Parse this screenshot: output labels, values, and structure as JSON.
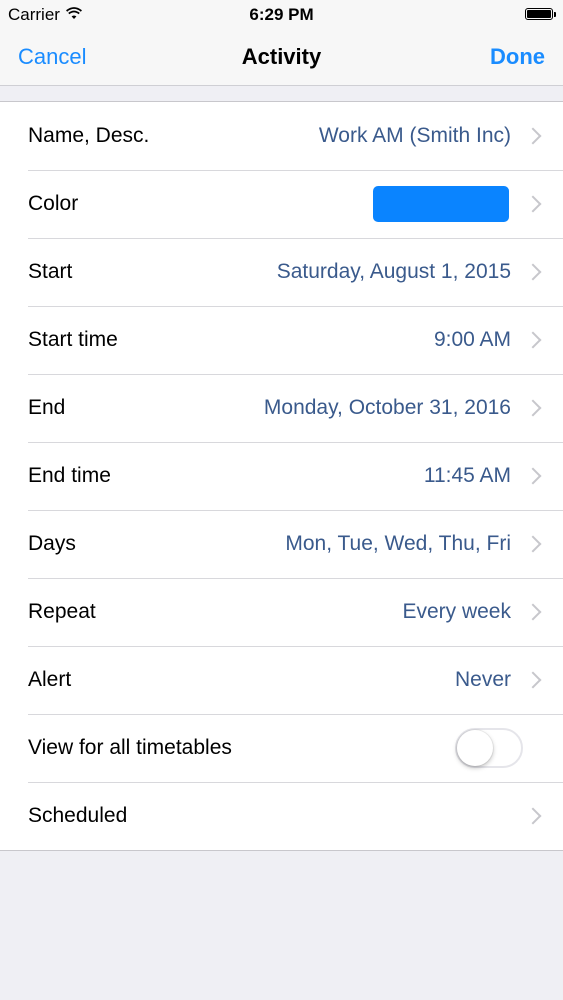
{
  "status_bar": {
    "carrier": "Carrier",
    "time": "6:29 PM"
  },
  "nav": {
    "cancel": "Cancel",
    "title": "Activity",
    "done": "Done"
  },
  "rows": [
    {
      "label": "Name, Desc.",
      "value": "Work AM (Smith Inc)"
    },
    {
      "label": "Color",
      "value": "",
      "swatch_color": "#0a84ff"
    },
    {
      "label": "Start",
      "value": "Saturday, August 1, 2015"
    },
    {
      "label": "Start time",
      "value": "9:00 AM"
    },
    {
      "label": "End",
      "value": "Monday, October 31, 2016"
    },
    {
      "label": "End time",
      "value": "11:45 AM"
    },
    {
      "label": "Days",
      "value": "Mon, Tue, Wed, Thu, Fri"
    },
    {
      "label": "Repeat",
      "value": "Every week"
    },
    {
      "label": "Alert",
      "value": "Never"
    },
    {
      "label": "View for all timetables",
      "toggle_on": false
    },
    {
      "label": "Scheduled",
      "value": ""
    }
  ],
  "colors": {
    "accent": "#1a8cff",
    "value_text": "#3a5a8c",
    "background": "#efeff4"
  }
}
